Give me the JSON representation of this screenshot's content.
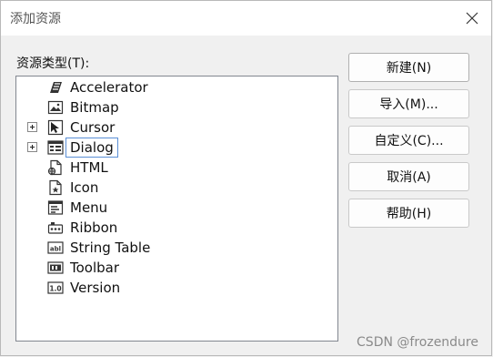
{
  "window": {
    "title": "添加资源"
  },
  "tree_label": "资源类型(T):",
  "tree": {
    "items": [
      {
        "label": "Accelerator",
        "icon": "accelerator-icon",
        "expandable": false,
        "selected": false
      },
      {
        "label": "Bitmap",
        "icon": "bitmap-icon",
        "expandable": false,
        "selected": false
      },
      {
        "label": "Cursor",
        "icon": "cursor-icon",
        "expandable": true,
        "selected": false
      },
      {
        "label": "Dialog",
        "icon": "dialog-icon",
        "expandable": true,
        "selected": true
      },
      {
        "label": "HTML",
        "icon": "html-file-icon",
        "expandable": false,
        "selected": false
      },
      {
        "label": "Icon",
        "icon": "icon-file-icon",
        "expandable": false,
        "selected": false
      },
      {
        "label": "Menu",
        "icon": "menu-icon",
        "expandable": false,
        "selected": false
      },
      {
        "label": "Ribbon",
        "icon": "ribbon-icon",
        "expandable": false,
        "selected": false
      },
      {
        "label": "String Table",
        "icon": "string-table-icon",
        "expandable": false,
        "selected": false
      },
      {
        "label": "Toolbar",
        "icon": "toolbar-icon",
        "expandable": false,
        "selected": false
      },
      {
        "label": "Version",
        "icon": "version-icon",
        "expandable": false,
        "selected": false
      }
    ]
  },
  "buttons": {
    "new": "新建(N)",
    "import": "导入(M)...",
    "custom": "自定义(C)...",
    "cancel": "取消(A)",
    "help": "帮助(H)"
  },
  "watermark": "CSDN @frozendure"
}
